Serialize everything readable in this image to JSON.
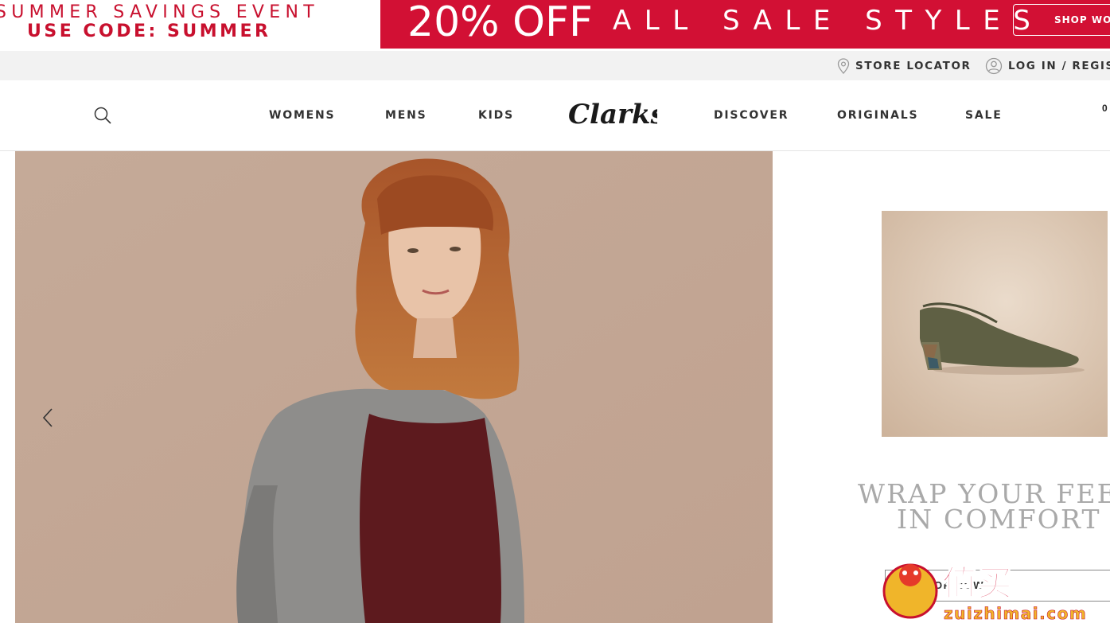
{
  "promo": {
    "line1": "SUMMER SAVINGS EVENT",
    "line2": "USE CODE: SUMMER",
    "percent": "20% OFF",
    "styles": "ALL SALE STYLES",
    "cta": "SHOP WOMENS",
    "accent_color": "#d21034"
  },
  "utility": {
    "store_locator": "STORE LOCATOR",
    "login": "LOG IN / REGISTER",
    "store_icon": "location-pin-icon",
    "login_icon": "user-icon"
  },
  "nav": {
    "search_icon": "search-icon",
    "links_left": [
      "WOMENS",
      "MENS",
      "KIDS"
    ],
    "logo": "Clarks",
    "links_right": [
      "DISCOVER",
      "ORIGINALS",
      "SALE"
    ],
    "cart_count": "0"
  },
  "hero": {
    "prev_icon": "chevron-left-icon"
  },
  "side": {
    "title_line1": "WRAP YOUR FEET",
    "title_line2": "IN COMFORT",
    "button": "SHOP NOW"
  },
  "watermark": {
    "brand": "值买",
    "url": "zuizhimai.com"
  }
}
